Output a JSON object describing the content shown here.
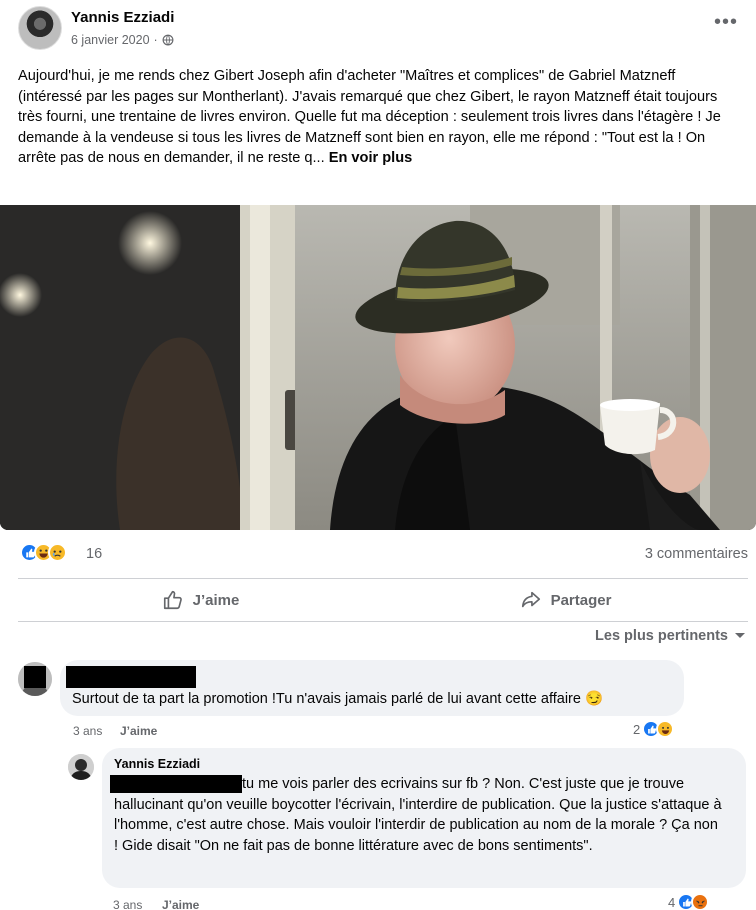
{
  "post": {
    "author": "Yannis Ezziadi",
    "date": "6 janvier 2020",
    "meta_separator": "·",
    "text": "Aujourd'hui, je me rends chez Gibert Joseph afin d'acheter \"Maîtres et complices\" de Gabriel Matzneff (intéressé par les pages sur Montherlant). J'avais remarqué que chez Gibert, le rayon Matzneff était toujours très fourni, une trentaine de livres environ. Quelle fut ma déception : seulement trois livres dans l'étagère ! Je demande à la vendeuse si tous les livres de Matzneff sont bien en rayon, elle me répond : \"Tout est la ! On arrête pas de nous en demander, il ne reste q...",
    "see_more": "En voir plus",
    "more_icon": "more-horizontal-icon"
  },
  "stats": {
    "reaction_count": "16",
    "comments": "3 commentaires",
    "reaction_icons": [
      "like-icon",
      "haha-icon",
      "sad-icon"
    ]
  },
  "actions": {
    "like": "J’aime",
    "share": "Partager"
  },
  "sort": {
    "label": "Les plus pertinents"
  },
  "comments": [
    {
      "text": "Surtout de ta part la promotion !Tu n'avais jamais parlé de lui avant cette affaire 😏",
      "time": "3 ans",
      "like": "J’aime",
      "reaction_count": "2"
    },
    {
      "author": "Yannis Ezziadi",
      "text": "tu me vois parler des ecrivains sur fb ? Non. C'est juste que je trouve hallucinant qu'on veuille boycotter l'écrivain, l'interdire de publication. Que la justice s'attaque à l'homme, c'est autre chose. Mais vouloir l'interdir de publication au nom de la morale ? Ça non ! Gide disait \"On ne fait pas de bonne littérature avec de bons sentiments\".",
      "time": "3 ans",
      "like": "J’aime",
      "reaction_count": "4"
    }
  ],
  "colors": {
    "like_blue": "#1877f2",
    "haha_yellow": "#f7b928",
    "angry_orange": "#e9710f",
    "muted_text": "#65676b",
    "bubble_bg": "#f0f2f5"
  }
}
